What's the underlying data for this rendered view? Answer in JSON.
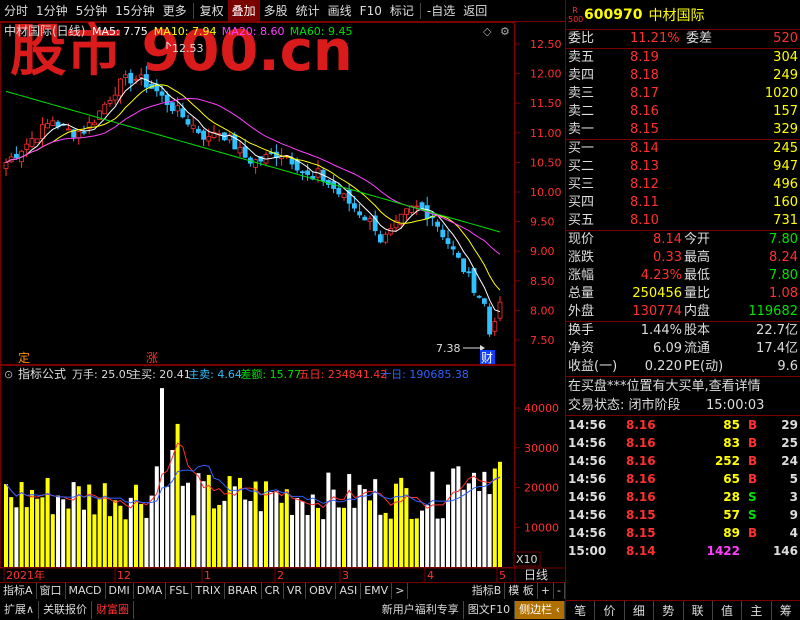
{
  "toolbar": {
    "items": [
      "分时",
      "1分钟",
      "5分钟",
      "15分钟",
      "更多",
      "复权",
      "叠加",
      "多股",
      "统计",
      "画线",
      "F10",
      "标记",
      "-自选",
      "返回"
    ]
  },
  "chart": {
    "title": "中材国际(日线)",
    "ma": [
      {
        "label": "MA5: 7.75",
        "color": "#ffffff"
      },
      {
        "label": "MA10: 7.94",
        "color": "#ffff00"
      },
      {
        "label": "MA20: 8.60",
        "color": "#ff40ff"
      },
      {
        "label": "MA60: 9.45",
        "color": "#00e000"
      }
    ],
    "price_axis": [
      "12.50",
      "12.00",
      "11.50",
      "11.00",
      "10.50",
      "10.00",
      "9.50",
      "9.00",
      "8.50",
      "8.00",
      "7.50"
    ],
    "high_label": "12.53",
    "low_label": "7.38",
    "marker_ding": "定",
    "marker_zhang": "涨",
    "marker_cai": "财",
    "indicator_label": "指标公式",
    "ind": [
      {
        "label": "万手: 25.05",
        "color": "#dddddd"
      },
      {
        "label": "主买: 20.41",
        "color": "#dddddd"
      },
      {
        "label": "主卖: 4.64",
        "color": "#30c0ff"
      },
      {
        "label": "差额: 15.77",
        "color": "#00e000"
      },
      {
        "label": "五日: 234841.42",
        "color": "#ff3030"
      },
      {
        "label": "十日: 190685.38",
        "color": "#3060ff"
      }
    ],
    "vol_axis": [
      "40000",
      "30000",
      "20000",
      "10000"
    ],
    "vol_unit": "X10",
    "date_labels": [
      "2021年",
      "12",
      "1",
      "2",
      "3",
      "4",
      "5"
    ],
    "period": "日线"
  },
  "tabs_row1": [
    "指标A",
    "窗口",
    "MACD",
    "DMI",
    "DMA",
    "FSL",
    "TRIX",
    "BRAR",
    "CR",
    "VR",
    "OBV",
    "ASI",
    "EMV",
    ">",
    "指标B",
    "模 板",
    "+",
    "-"
  ],
  "tabs_row2": [
    {
      "label": "扩展∧",
      "red": false
    },
    {
      "label": "关联报价",
      "red": false
    },
    {
      "label": "财富圈",
      "red": true
    },
    {
      "label": "新用户福利专享",
      "red": false
    },
    {
      "label": "图文F10",
      "red": false
    },
    {
      "label": "侧边栏 ‹",
      "red": false
    }
  ],
  "quote": {
    "r_badge": "R",
    "r_sub": "500",
    "code": "600970",
    "name": "中材国际",
    "weibi_label": "委比",
    "weibi": "11.21%",
    "weicha_label": "委差",
    "weicha": "520",
    "asks": [
      {
        "label": "卖五",
        "price": "8.19",
        "vol": "304"
      },
      {
        "label": "卖四",
        "price": "8.18",
        "vol": "249"
      },
      {
        "label": "卖三",
        "price": "8.17",
        "vol": "1020"
      },
      {
        "label": "卖二",
        "price": "8.16",
        "vol": "157"
      },
      {
        "label": "卖一",
        "price": "8.15",
        "vol": "329"
      }
    ],
    "bids": [
      {
        "label": "买一",
        "price": "8.14",
        "vol": "245"
      },
      {
        "label": "买二",
        "price": "8.13",
        "vol": "947"
      },
      {
        "label": "买三",
        "price": "8.12",
        "vol": "496"
      },
      {
        "label": "买四",
        "price": "8.11",
        "vol": "160"
      },
      {
        "label": "买五",
        "price": "8.10",
        "vol": "731"
      }
    ],
    "stats": [
      {
        "l1": "现价",
        "v1": "8.14",
        "c1": "red",
        "l2": "今开",
        "v2": "7.80",
        "c2": "green"
      },
      {
        "l1": "涨跌",
        "v1": "0.33",
        "c1": "red",
        "l2": "最高",
        "v2": "8.24",
        "c2": "red"
      },
      {
        "l1": "涨幅",
        "v1": "4.23%",
        "c1": "red",
        "l2": "最低",
        "v2": "7.80",
        "c2": "green"
      },
      {
        "l1": "总量",
        "v1": "250456",
        "c1": "yellow",
        "l2": "量比",
        "v2": "1.08",
        "c2": "red"
      },
      {
        "l1": "外盘",
        "v1": "130774",
        "c1": "red",
        "l2": "内盘",
        "v2": "119682",
        "c2": "green"
      }
    ],
    "stats2": [
      {
        "l1": "换手",
        "v1": "1.44%",
        "l2": "股本",
        "v2": "22.7亿"
      },
      {
        "l1": "净资",
        "v1": "6.09",
        "l2": "流通",
        "v2": "17.4亿"
      },
      {
        "l1": "收益(一)",
        "v1": "0.220",
        "l2": "PE(动)",
        "v2": "9.6"
      }
    ],
    "notice": "在买盘***位置有大买单,查看详情",
    "status_label": "交易状态: 闭市阶段",
    "status_time": "15:00:03",
    "ticks": [
      {
        "t": "14:56",
        "p": "8.16",
        "v": "85",
        "bs": "B",
        "c": "29"
      },
      {
        "t": "14:56",
        "p": "8.16",
        "v": "83",
        "bs": "B",
        "c": "25"
      },
      {
        "t": "14:56",
        "p": "8.16",
        "v": "252",
        "bs": "B",
        "c": "24"
      },
      {
        "t": "14:56",
        "p": "8.16",
        "v": "65",
        "bs": "B",
        "c": "5"
      },
      {
        "t": "14:56",
        "p": "8.16",
        "v": "28",
        "bs": "S",
        "c": "3"
      },
      {
        "t": "14:56",
        "p": "8.15",
        "v": "57",
        "bs": "S",
        "c": "9"
      },
      {
        "t": "14:56",
        "p": "8.15",
        "v": "89",
        "bs": "B",
        "c": "4"
      },
      {
        "t": "15:00",
        "p": "8.14",
        "v": "1422",
        "bs": "",
        "c": "146"
      }
    ],
    "bottom_tabs": [
      "笔",
      "价",
      "细",
      "势",
      "联",
      "值",
      "主",
      "筹"
    ]
  },
  "watermark": "股市 900.cn",
  "colors": {
    "up": "#ff3030",
    "down": "#30c0ff",
    "ma5": "#ffffff",
    "ma10": "#ffff00",
    "ma20": "#ff40ff",
    "ma60": "#00e000",
    "vol_up": "#ffff00",
    "vol_down": "#ffffff"
  }
}
